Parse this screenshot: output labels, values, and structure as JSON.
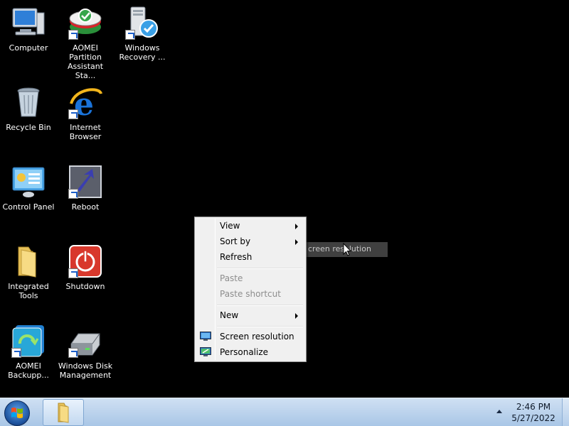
{
  "desktop": {
    "icons": [
      {
        "label": "Computer"
      },
      {
        "label": "AOMEI Partition Assistant Sta..."
      },
      {
        "label": "Windows Recovery ..."
      },
      {
        "label": "Recycle Bin"
      },
      {
        "label": "Internet Browser"
      },
      {
        "label": "Control Panel"
      },
      {
        "label": "Reboot"
      },
      {
        "label": "Integrated Tools"
      },
      {
        "label": "Shutdown"
      },
      {
        "label": "AOMEI Backupp..."
      },
      {
        "label": "Windows Disk Management"
      }
    ]
  },
  "context_menu": {
    "items": [
      {
        "label": "View",
        "submenu": true
      },
      {
        "label": "Sort by",
        "submenu": true
      },
      {
        "label": "Refresh"
      },
      {
        "label": "Paste",
        "disabled": true
      },
      {
        "label": "Paste shortcut",
        "disabled": true
      },
      {
        "label": "New",
        "submenu": true
      },
      {
        "label": "Screen resolution",
        "icon": "screen-resolution-icon"
      },
      {
        "label": "Personalize",
        "icon": "personalize-icon"
      }
    ]
  },
  "tooltip": {
    "text": "creen resolution"
  },
  "taskbar": {
    "clock_time": "2:46 PM",
    "clock_date": "5/27/2022"
  }
}
